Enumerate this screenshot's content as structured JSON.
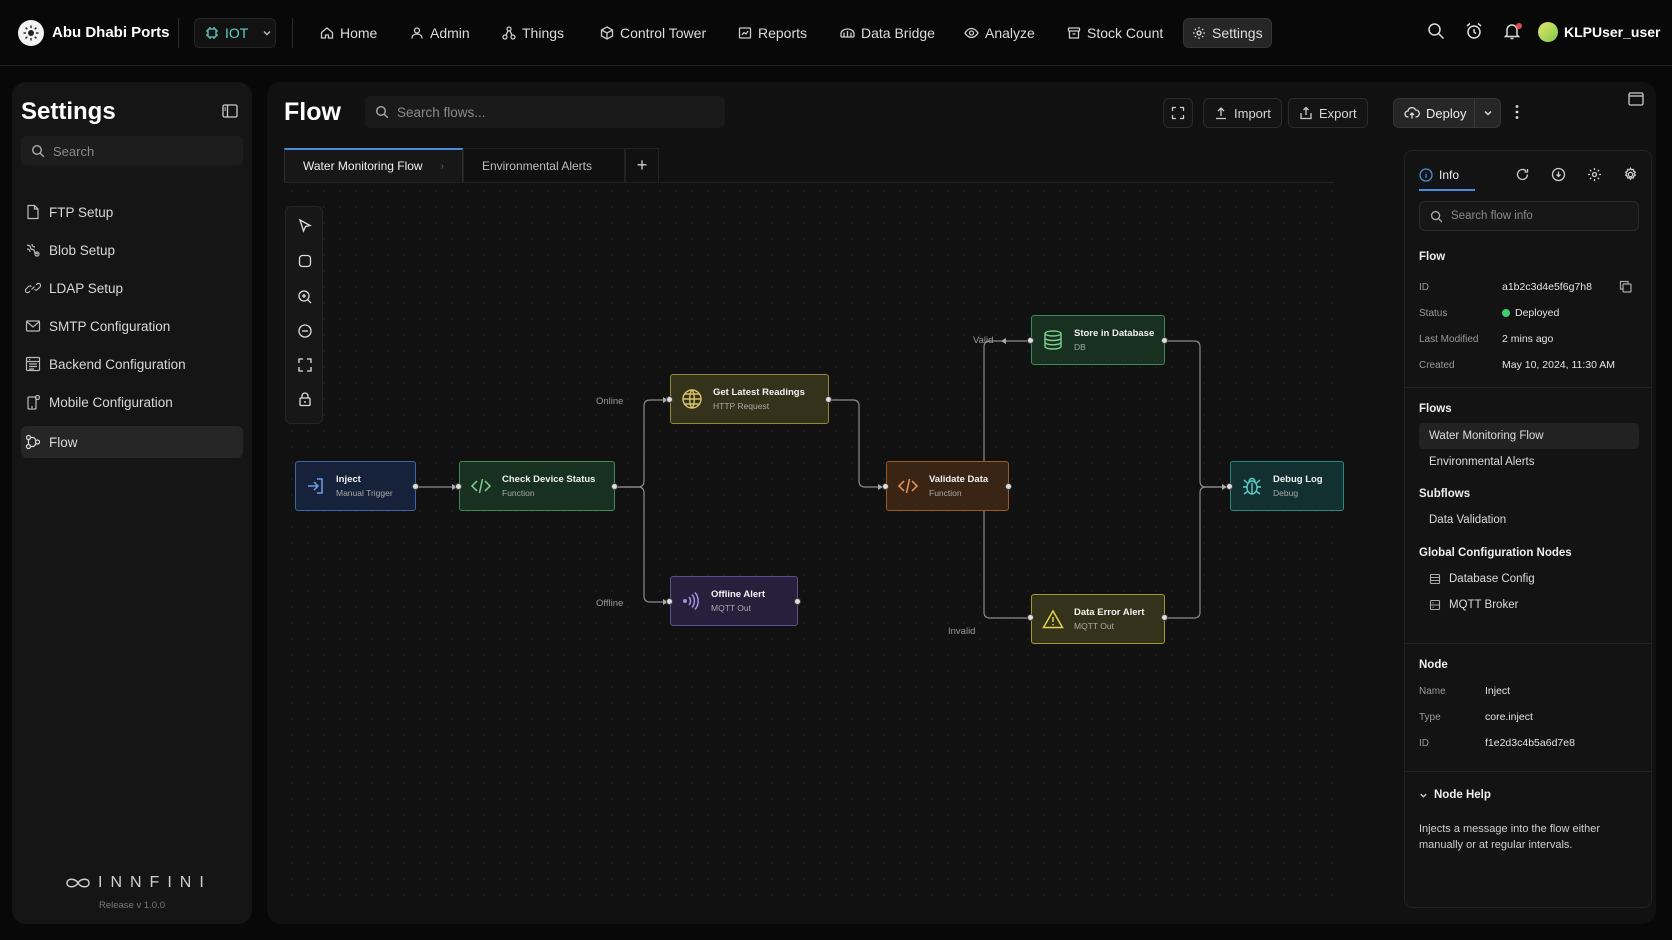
{
  "topbar": {
    "brand": "Abu Dhabi Ports",
    "module": "IOT",
    "nav": [
      {
        "label": "Home",
        "icon": "home-icon"
      },
      {
        "label": "Admin",
        "icon": "user-icon"
      },
      {
        "label": "Things",
        "icon": "things-icon"
      },
      {
        "label": "Control Tower",
        "icon": "tower-icon"
      },
      {
        "label": "Reports",
        "icon": "reports-icon"
      },
      {
        "label": "Data Bridge",
        "icon": "bridge-icon"
      },
      {
        "label": "Analyze",
        "icon": "analyze-icon"
      },
      {
        "label": "Stock Count",
        "icon": "stock-icon"
      },
      {
        "label": "Settings",
        "icon": "gear-icon",
        "active": true
      }
    ],
    "user": "KLPUser_user"
  },
  "sidebar": {
    "title": "Settings",
    "search_placeholder": "Search",
    "items": [
      {
        "label": "FTP Setup",
        "icon": "file-icon"
      },
      {
        "label": "Blob Setup",
        "icon": "blob-icon"
      },
      {
        "label": "LDAP Setup",
        "icon": "link-icon"
      },
      {
        "label": "SMTP Configuration",
        "icon": "mail-icon"
      },
      {
        "label": "Backend Configuration",
        "icon": "backend-icon"
      },
      {
        "label": "Mobile Configuration",
        "icon": "mobile-icon"
      },
      {
        "label": "Flow",
        "icon": "flow-icon",
        "active": true
      }
    ],
    "footer_brand": "INNFINI",
    "release": "Release v 1.0.0"
  },
  "main": {
    "title": "Flow",
    "search_placeholder": "Search flows...",
    "import_label": "Import",
    "export_label": "Export",
    "deploy_label": "Deploy",
    "tabs": [
      {
        "label": "Water Monitoring Flow",
        "active": true
      },
      {
        "label": "Environmental Alerts"
      }
    ]
  },
  "nodes": {
    "inject": {
      "title": "Inject",
      "sub": "Manual Trigger"
    },
    "check": {
      "title": "Check Device Status",
      "sub": "Function"
    },
    "readings": {
      "title": "Get Latest Readings",
      "sub": "HTTP Request"
    },
    "offline": {
      "title": "Offline Alert",
      "sub": "MQTT Out"
    },
    "validate": {
      "title": "Validate Data",
      "sub": "Function"
    },
    "store": {
      "title": "Store in Database",
      "sub": "DB"
    },
    "error": {
      "title": "Data Error Alert",
      "sub": "MQTT Out"
    },
    "debug": {
      "title": "Debug Log",
      "sub": "Debug"
    }
  },
  "wire_labels": {
    "online": "Online",
    "offline": "Offline",
    "valid": "Valid",
    "invalid": "Invalid"
  },
  "panel": {
    "tab": "Info",
    "search_placeholder": "Search flow info",
    "flow_heading": "Flow",
    "flow": {
      "id_label": "ID",
      "id": "a1b2c3d4e5f6g7h8",
      "status_label": "Status",
      "status": "Deployed",
      "modified_label": "Last Modified",
      "modified": "2 mins ago",
      "created_label": "Created",
      "created": "May 10, 2024, 11:30 AM"
    },
    "flows_heading": "Flows",
    "flows": [
      "Water Monitoring Flow",
      "Environmental Alerts"
    ],
    "subflows_heading": "Subflows",
    "subflows": [
      "Data Validation"
    ],
    "global_heading": "Global Configuration Nodes",
    "global": [
      "Database Config",
      "MQTT Broker"
    ],
    "node_heading": "Node",
    "node": {
      "name_label": "Name",
      "name": "Inject",
      "type_label": "Type",
      "type": "core.inject",
      "id_label": "ID",
      "id": "f1e2d3c4b5a6d7e8"
    },
    "help_heading": "Node Help",
    "help_text": "Injects a message into the flow either manually or at regular intervals."
  },
  "colors": {
    "accent": "#4a8dde",
    "deployed": "#3ecf6e"
  }
}
